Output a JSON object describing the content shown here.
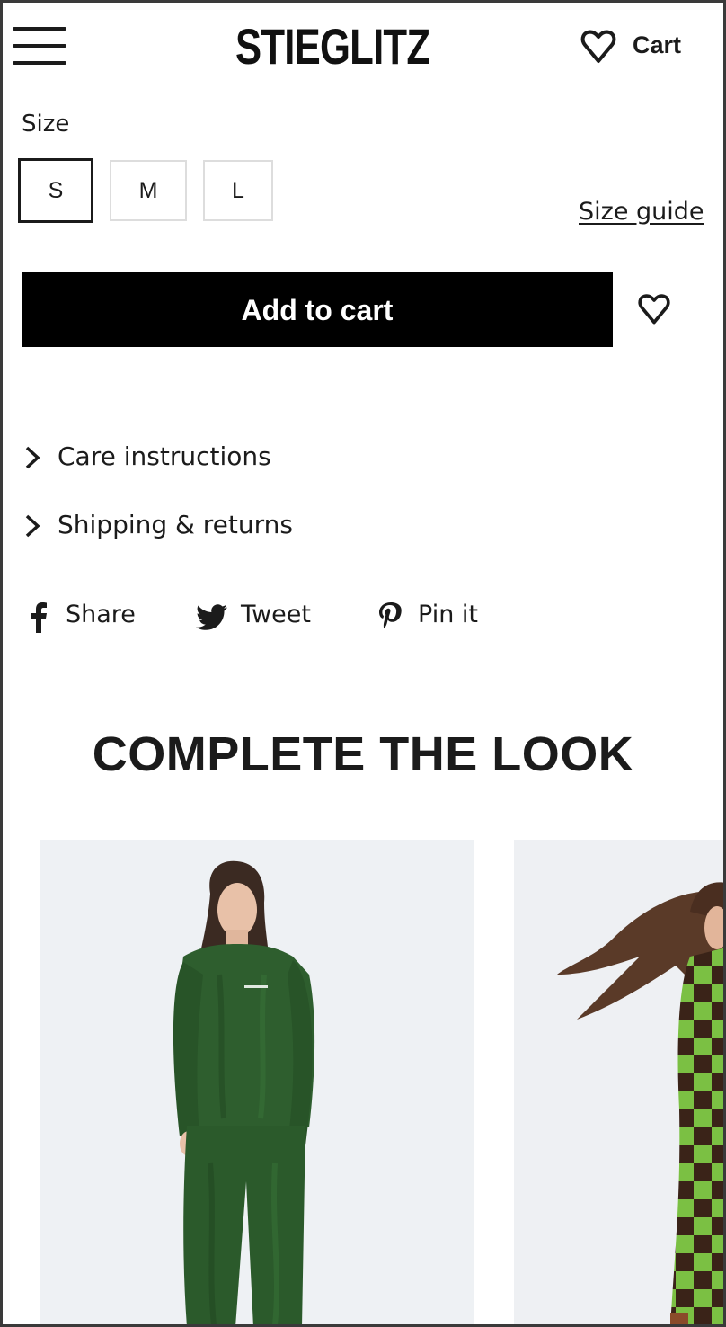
{
  "header": {
    "brand": "STIEGLITZ",
    "cart_label": "Cart",
    "menu_icon": "hamburger-icon",
    "wishlist_icon": "heart-icon"
  },
  "size": {
    "label": "Size",
    "options": [
      "S",
      "M",
      "L"
    ],
    "selected": "S",
    "guide_label": "Size guide"
  },
  "actions": {
    "add_to_cart": "Add to cart",
    "wishlist_icon": "heart-icon"
  },
  "accordions": [
    {
      "label": "Care instructions",
      "icon": "chevron-right-icon"
    },
    {
      "label": "Shipping & returns",
      "icon": "chevron-right-icon"
    }
  ],
  "share": [
    {
      "label": "Share",
      "icon": "facebook-icon"
    },
    {
      "label": "Tweet",
      "icon": "twitter-icon"
    },
    {
      "label": "Pin it",
      "icon": "pinterest-icon"
    }
  ],
  "complete_the_look": {
    "title": "COMPLETE THE LOOK",
    "products": [
      {
        "image": "green velour sweatshirt and pants",
        "color": "#2e5e2e"
      },
      {
        "image": "green and brown checkered coat",
        "color": "#7bc043"
      }
    ]
  },
  "colors": {
    "text": "#1b1b1b",
    "button_bg": "#000000",
    "button_text": "#ffffff",
    "border_light": "#dddddd"
  }
}
